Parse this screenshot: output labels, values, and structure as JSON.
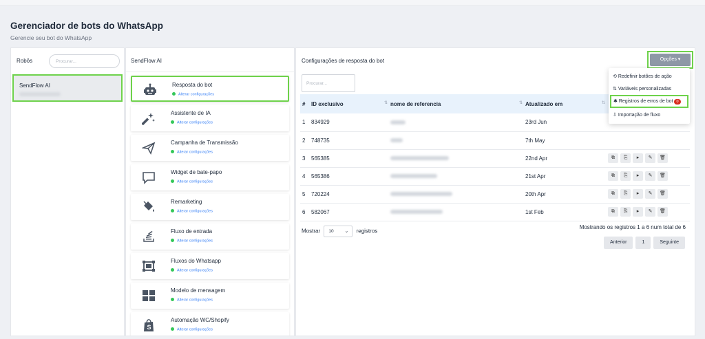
{
  "page": {
    "title": "Gerenciador de bots do WhatsApp",
    "subtitle": "Gerencie seu bot do WhatsApp"
  },
  "bots_panel": {
    "header": "Robôs",
    "search_placeholder": "Procurar...",
    "items": [
      {
        "name": "SendFlow AI"
      }
    ]
  },
  "features_panel": {
    "header": "SendFlow AI",
    "items": [
      {
        "title": "Resposta do bot",
        "sub": "Alterar configurações",
        "icon": "robot-icon"
      },
      {
        "title": "Assistente de IA",
        "sub": "Alterar configurações",
        "icon": "magic-wand-icon"
      },
      {
        "title": "Campanha de Transmissão",
        "sub": "Alterar configurações",
        "icon": "paper-plane-icon"
      },
      {
        "title": "Widget de bate-papo",
        "sub": "Alterar configurações",
        "icon": "chat-bubble-icon"
      },
      {
        "title": "Remarketing",
        "sub": "Alterar configurações",
        "icon": "paint-bucket-icon"
      },
      {
        "title": "Fluxo de entrada",
        "sub": "Alterar configurações",
        "icon": "stack-icon"
      },
      {
        "title": "Fluxos do Whatsapp",
        "sub": "Alterar configurações",
        "icon": "flow-frame-icon"
      },
      {
        "title": "Modelo de mensagem",
        "sub": "Alterar configurações",
        "icon": "grid-template-icon"
      },
      {
        "title": "Automação WC/Shopify",
        "sub": "Alterar configurações",
        "icon": "shopify-bag-icon"
      }
    ]
  },
  "responses_panel": {
    "header": "Configurações de resposta do bot",
    "options_button": "Opções ▾",
    "search_placeholder": "Procurar...",
    "columns": [
      "#",
      "ID exclusivo",
      "nome de referencia",
      "Atualizado em",
      ""
    ],
    "rows": [
      {
        "n": "1",
        "id": "834929",
        "updated": "23rd Jun"
      },
      {
        "n": "2",
        "id": "748735",
        "updated": "7th May"
      },
      {
        "n": "3",
        "id": "565385",
        "updated": "22nd Apr"
      },
      {
        "n": "4",
        "id": "565386",
        "updated": "21st Apr"
      },
      {
        "n": "5",
        "id": "720224",
        "updated": "20th Apr"
      },
      {
        "n": "6",
        "id": "582067",
        "updated": "1st Feb"
      }
    ],
    "show_label": "Mostrar",
    "page_size": "10",
    "records_label": "registros",
    "showing_text": "Mostrando os registros 1 a 6 num total de 6",
    "prev": "Anterior",
    "page": "1",
    "next": "Seguinte"
  },
  "options_menu": {
    "items": [
      {
        "label": "Redefinir botões de ação",
        "icon": "reset-icon"
      },
      {
        "label": "Variáveis personalizadas",
        "icon": "sort-vars-icon"
      },
      {
        "label": "Registros de erros de bot",
        "icon": "bug-icon",
        "badge": "0"
      },
      {
        "label": "Importação de fluxo",
        "icon": "import-icon"
      }
    ]
  }
}
